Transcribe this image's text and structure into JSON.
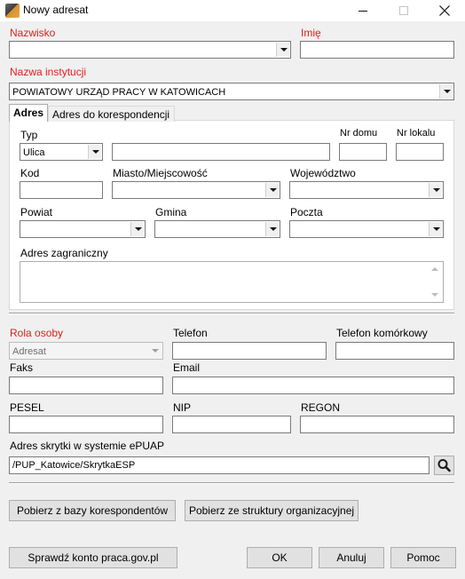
{
  "window": {
    "title": "Nowy adresat"
  },
  "labels": {
    "nazwisko": "Nazwisko",
    "imie": "Imię",
    "nazwa_instytucji": "Nazwa instytucji",
    "typ": "Typ",
    "nr_domu": "Nr domu",
    "nr_lokalu": "Nr lokalu",
    "kod": "Kod",
    "miasto": "Miasto/Miejscowość",
    "wojewodztwo": "Województwo",
    "powiat": "Powiat",
    "gmina": "Gmina",
    "poczta": "Poczta",
    "adres_zagraniczny": "Adres zagraniczny",
    "rola_osoby": "Rola osoby",
    "telefon": "Telefon",
    "telefon_komorkowy": "Telefon komórkowy",
    "faks": "Faks",
    "email": "Email",
    "pesel": "PESEL",
    "nip": "NIP",
    "regon": "REGON",
    "adres_skrytki": "Adres skrytki w systemie ePUAP"
  },
  "values": {
    "nazwisko": "",
    "imie": "",
    "nazwa_instytucji": "POWIATOWY URZĄD PRACY W KATOWICACH",
    "typ": "Ulica",
    "ulica": "",
    "nr_domu": "",
    "nr_lokalu": "",
    "kod": "",
    "miasto": "",
    "wojewodztwo": "",
    "powiat": "",
    "gmina": "",
    "poczta": "",
    "adres_zagraniczny": "",
    "rola_osoby": "Adresat",
    "telefon": "",
    "telefon_komorkowy": "",
    "faks": "",
    "email": "",
    "pesel": "",
    "nip": "",
    "regon": "",
    "adres_skrytki": "/PUP_Katowice/SkrytkaESP"
  },
  "tabs": [
    {
      "label": "Adres",
      "active": true
    },
    {
      "label": "Adres do korespondencji",
      "active": false
    }
  ],
  "buttons": {
    "pobierz_baza": "Pobierz z bazy korespondentów",
    "pobierz_struktura": "Pobierz ze struktury organizacyjnej",
    "sprawdz_konto": "Sprawdź konto praca.gov.pl",
    "ok": "OK",
    "anuluj": "Anuluj",
    "pomoc": "Pomoc"
  },
  "colors": {
    "required_label": "#e0201c",
    "window_bg": "#f0f0f0"
  }
}
